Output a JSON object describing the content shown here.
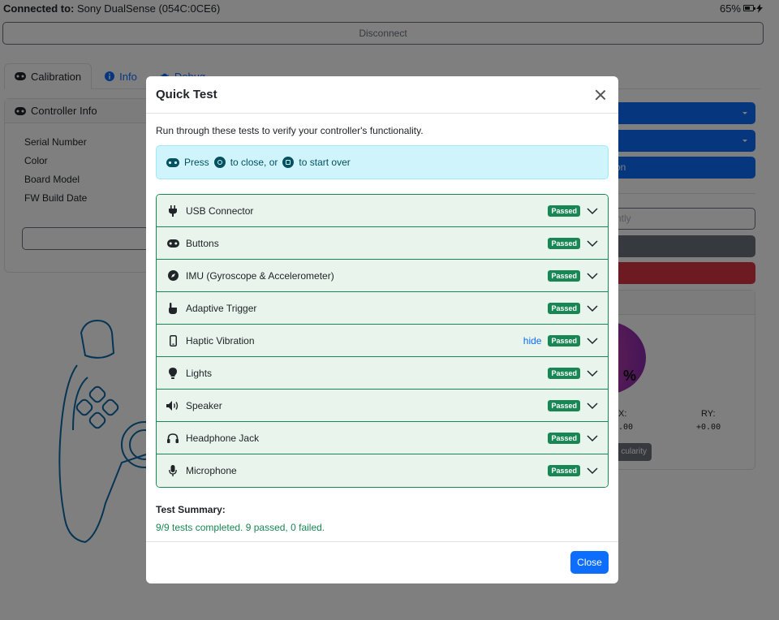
{
  "topbar": {
    "connected_label": "Connected to:",
    "device_name": "Sony DualSense (054C:0CE6)",
    "battery_percent": "65%"
  },
  "disconnect_label": "Disconnect",
  "tabs": [
    {
      "label": "Calibration"
    },
    {
      "label": "Info"
    },
    {
      "label": "Debug"
    }
  ],
  "controller_info": {
    "title": "Controller Info",
    "rows": [
      "Serial Number",
      "Color",
      "Board Model",
      "FW Build Date"
    ]
  },
  "right_panel": {
    "blue_button_3_fragment": "on",
    "outline_button_fragment": "ntly",
    "stick_percent_fragment": "%",
    "lx_label_fragment": "X:",
    "lx_value_fragment": ".00",
    "ry_label": "RY:",
    "ry_value": "+0.00",
    "circularity_fragment": "cularity"
  },
  "modal": {
    "title": "Quick Test",
    "intro": "Run through these tests to verify your controller's functionality.",
    "alert": {
      "prefix": "Press",
      "middle": "to close, or",
      "suffix": "to start over"
    },
    "tests": [
      {
        "name": "USB Connector",
        "status": "Passed",
        "icon": "plug-icon"
      },
      {
        "name": "Buttons",
        "status": "Passed",
        "icon": "gamepad-icon"
      },
      {
        "name": "IMU (Gyroscope & Accelerometer)",
        "status": "Passed",
        "icon": "compass-icon"
      },
      {
        "name": "Adaptive Trigger",
        "status": "Passed",
        "icon": "hand-pointer-icon"
      },
      {
        "name": "Haptic Vibration",
        "status": "Passed",
        "icon": "mobile-icon",
        "link": "hide"
      },
      {
        "name": "Lights",
        "status": "Passed",
        "icon": "lightbulb-icon"
      },
      {
        "name": "Speaker",
        "status": "Passed",
        "icon": "volume-icon"
      },
      {
        "name": "Headphone Jack",
        "status": "Passed",
        "icon": "headphones-icon"
      },
      {
        "name": "Microphone",
        "status": "Passed",
        "icon": "microphone-icon"
      }
    ],
    "summary_title": "Test Summary:",
    "summary_text": "9/9 tests completed. 9 passed, 0 failed.",
    "close_label": "Close"
  },
  "colors": {
    "primary": "#0d6efd",
    "success": "#198754",
    "danger": "#dc3545",
    "info_bg": "#cff4fc"
  }
}
